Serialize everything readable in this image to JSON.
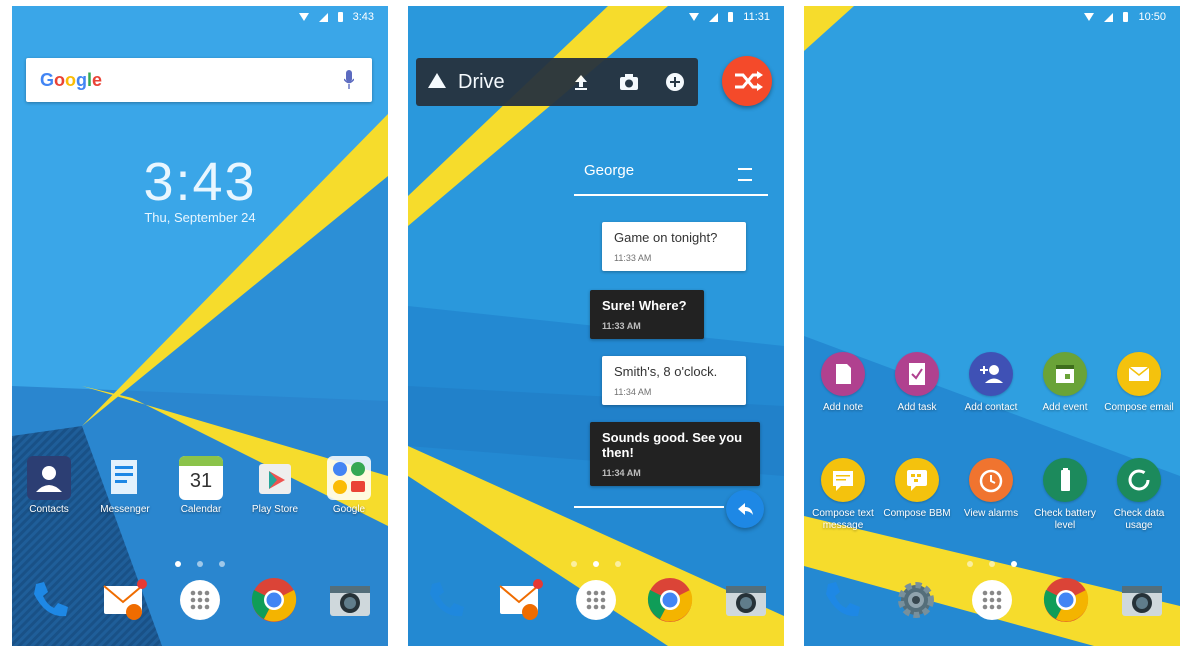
{
  "screen1": {
    "status_time": "3:43",
    "search_logo": "Google",
    "clock": "3:43",
    "date": "Thu, September 24",
    "apps": [
      {
        "label": "Contacts",
        "icon": "contacts-icon",
        "color": "#2c3e73"
      },
      {
        "label": "Messenger",
        "icon": "messenger-icon",
        "color": "#ffffff"
      },
      {
        "label": "Calendar",
        "icon": "calendar-icon",
        "color": "#ffffff",
        "day": "31"
      },
      {
        "label": "Play Store",
        "icon": "play-store-icon",
        "color": "#ffffff"
      },
      {
        "label": "Google",
        "icon": "google-folder-icon",
        "color": "#ffffff"
      }
    ],
    "dock": [
      "phone-icon",
      "hub-icon",
      "app-drawer-icon",
      "chrome-icon",
      "camera-icon"
    ]
  },
  "screen2": {
    "status_time": "11:31",
    "drive_label": "Drive",
    "drive_actions": [
      "upload-icon",
      "camera-icon",
      "add-icon"
    ],
    "contact": "George",
    "messages": [
      {
        "text": "Game on tonight?",
        "time": "11:33 AM",
        "dir": "in"
      },
      {
        "text": "Sure! Where?",
        "time": "11:33 AM",
        "dir": "out"
      },
      {
        "text": "Smith's, 8 o'clock.",
        "time": "11:34 AM",
        "dir": "in"
      },
      {
        "text": "Sounds good.  See you then!",
        "time": "11:34 AM",
        "dir": "out"
      }
    ]
  },
  "screen3": {
    "status_time": "10:50",
    "shortcuts_row1": [
      {
        "label": "Add note",
        "color": "#b0418f"
      },
      {
        "label": "Add task",
        "color": "#b0418f"
      },
      {
        "label": "Add contact",
        "color": "#3f51b5"
      },
      {
        "label": "Add event",
        "color": "#6aa338"
      },
      {
        "label": "Compose email",
        "color": "#f4c20d"
      }
    ],
    "shortcuts_row2": [
      {
        "label": "Compose text message",
        "color": "#f4c20d"
      },
      {
        "label": "Compose BBM",
        "color": "#f4c20d"
      },
      {
        "label": "View alarms",
        "color": "#f0742f"
      },
      {
        "label": "Check battery level",
        "color": "#1c8a5c"
      },
      {
        "label": "Check data usage",
        "color": "#1c8a5c"
      }
    ]
  }
}
